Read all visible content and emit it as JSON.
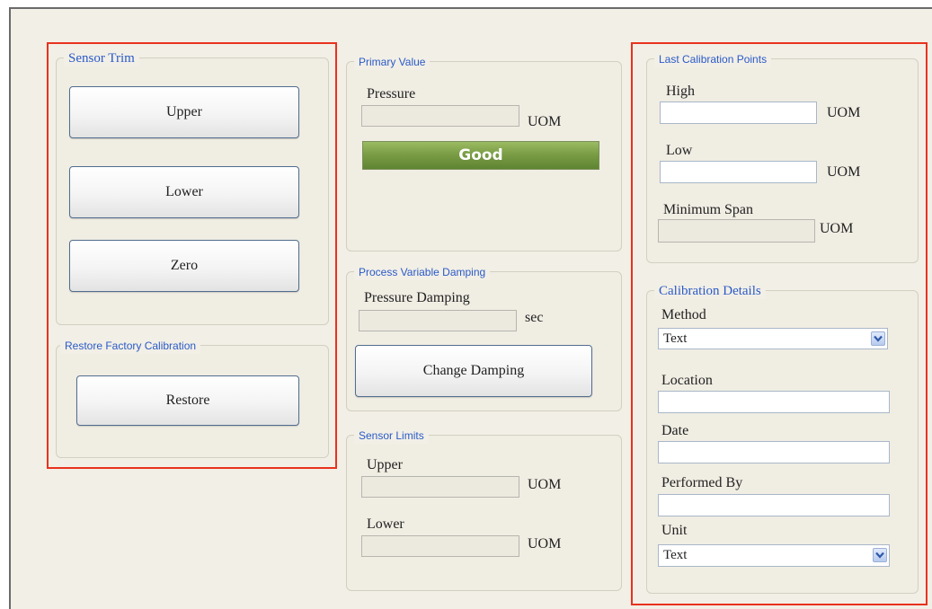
{
  "sensor_trim": {
    "title": "Sensor Trim",
    "upper_label": "Upper",
    "lower_label": "Lower",
    "zero_label": "Zero"
  },
  "restore_factory": {
    "title": "Restore Factory Calibration",
    "restore_label": "Restore"
  },
  "primary_value": {
    "title": "Primary Value",
    "pressure_label": "Pressure",
    "pressure_value": "",
    "unit": "UOM",
    "status_text": "Good",
    "status_color": "#7a9d45"
  },
  "damping": {
    "title": "Process Variable Damping",
    "pressure_damping_label": "Pressure Damping",
    "pressure_damping_value": "",
    "unit": "sec",
    "change_button_label": "Change Damping"
  },
  "sensor_limits": {
    "title": "Sensor Limits",
    "upper_label": "Upper",
    "upper_value": "",
    "upper_unit": "UOM",
    "lower_label": "Lower",
    "lower_value": "",
    "lower_unit": "UOM"
  },
  "last_calibration": {
    "title": "Last Calibration Points",
    "high_label": "High",
    "high_value": "",
    "high_unit": "UOM",
    "low_label": "Low",
    "low_value": "",
    "low_unit": "UOM",
    "min_span_label": "Minimum Span",
    "min_span_value": "",
    "min_span_unit": "UOM"
  },
  "calibration_details": {
    "title": "Calibration Details",
    "method_label": "Method",
    "method_selected": "Text",
    "location_label": "Location",
    "location_value": "",
    "date_label": "Date",
    "date_value": "",
    "performed_by_label": "Performed By",
    "performed_by_value": "",
    "unit_label": "Unit",
    "unit_selected": "Text"
  },
  "colors": {
    "highlight_border": "#e8321f",
    "legend_text": "#2a5ac8",
    "panel_background": "#f2efe6"
  }
}
